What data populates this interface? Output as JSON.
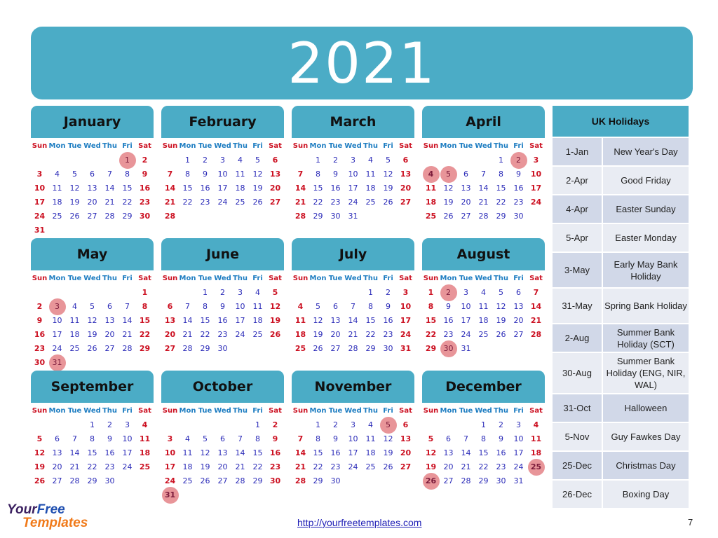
{
  "title": "2021",
  "weekdays": [
    "Sun",
    "Mon",
    "Tue",
    "Wed",
    "Thu",
    "Fri",
    "Sat"
  ],
  "months": [
    {
      "name": "January",
      "start": 5,
      "days": 31,
      "holidays": [
        1
      ]
    },
    {
      "name": "February",
      "start": 1,
      "days": 28,
      "holidays": []
    },
    {
      "name": "March",
      "start": 1,
      "days": 31,
      "holidays": []
    },
    {
      "name": "April",
      "start": 4,
      "days": 30,
      "holidays": [
        2,
        4,
        5
      ]
    },
    {
      "name": "May",
      "start": 6,
      "days": 31,
      "holidays": [
        3,
        31
      ]
    },
    {
      "name": "June",
      "start": 2,
      "days": 30,
      "holidays": []
    },
    {
      "name": "July",
      "start": 4,
      "days": 31,
      "holidays": []
    },
    {
      "name": "August",
      "start": 0,
      "days": 31,
      "holidays": [
        2,
        30
      ]
    },
    {
      "name": "September",
      "start": 3,
      "days": 30,
      "holidays": []
    },
    {
      "name": "October",
      "start": 5,
      "days": 31,
      "holidays": [
        31
      ]
    },
    {
      "name": "November",
      "start": 1,
      "days": 30,
      "holidays": [
        5
      ]
    },
    {
      "name": "December",
      "start": 3,
      "days": 31,
      "holidays": [
        25,
        26
      ]
    }
  ],
  "holidays_table": {
    "header": "UK Holidays",
    "rows": [
      {
        "date": "1-Jan",
        "name": "New Year's Day"
      },
      {
        "date": "2-Apr",
        "name": "Good Friday"
      },
      {
        "date": "4-Apr",
        "name": "Easter Sunday"
      },
      {
        "date": "5-Apr",
        "name": "Easter Monday"
      },
      {
        "date": "3-May",
        "name": "Early May Bank Holiday"
      },
      {
        "date": "31-May",
        "name": "Spring Bank Holiday"
      },
      {
        "date": "2-Aug",
        "name": "Summer Bank Holiday (SCT)"
      },
      {
        "date": "30-Aug",
        "name": "Summer Bank Holiday (ENG, NIR, WAL)"
      },
      {
        "date": "31-Oct",
        "name": "Halloween"
      },
      {
        "date": "5-Nov",
        "name": "Guy Fawkes Day"
      },
      {
        "date": "25-Dec",
        "name": "Christmas Day"
      },
      {
        "date": "26-Dec",
        "name": "Boxing Day"
      }
    ]
  },
  "colors": {
    "accent": "#4bacc6",
    "weekend": "#cc1122",
    "weekday": "#2a2ab8",
    "holiday_marker": "#e58a8e"
  },
  "logo": {
    "line1a": "Your",
    "line1b": "Free",
    "line2": "Templates"
  },
  "footer": {
    "link": "http://yourfreetemplates.com",
    "page": "7"
  }
}
